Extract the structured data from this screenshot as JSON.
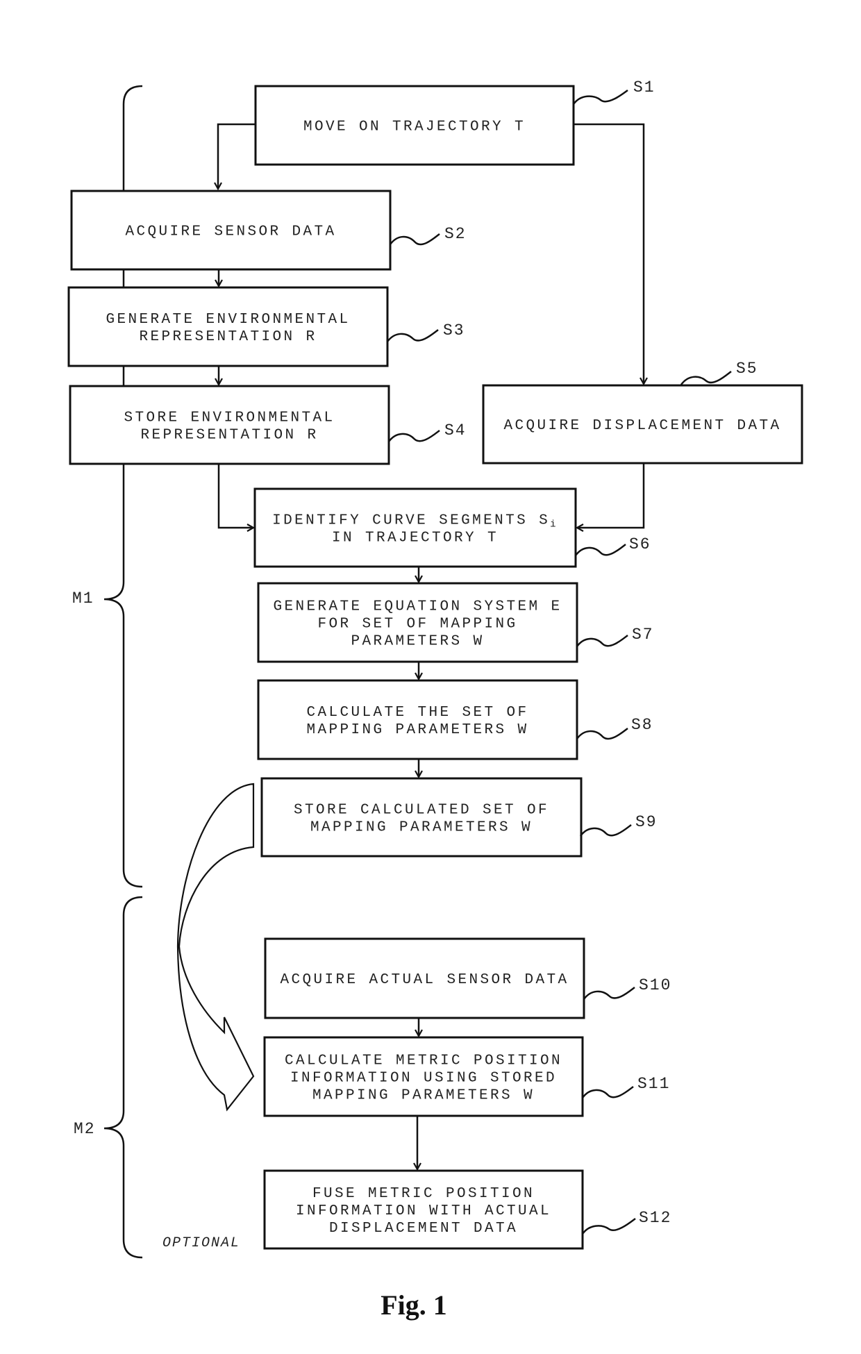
{
  "figure": {
    "caption": "Fig. 1",
    "phases": [
      {
        "id": "M1",
        "label": "M1"
      },
      {
        "id": "M2",
        "label": "M2"
      }
    ],
    "optional_note": "OPTIONAL",
    "steps": [
      {
        "id": "S1",
        "label": "S1",
        "lines": [
          "MOVE ON TRAJECTORY T"
        ]
      },
      {
        "id": "S2",
        "label": "S2",
        "lines": [
          "ACQUIRE SENSOR DATA"
        ]
      },
      {
        "id": "S3",
        "label": "S3",
        "lines": [
          "GENERATE ENVIRONMENTAL",
          "REPRESENTATION R"
        ]
      },
      {
        "id": "S4",
        "label": "S4",
        "lines": [
          "STORE ENVIRONMENTAL",
          "REPRESENTATION R"
        ]
      },
      {
        "id": "S5",
        "label": "S5",
        "lines": [
          "ACQUIRE DISPLACEMENT DATA"
        ]
      },
      {
        "id": "S6",
        "label": "S6",
        "lines": [
          "IDENTIFY CURVE SEGMENTS S",
          "IN TRAJECTORY T"
        ],
        "subscript": "i"
      },
      {
        "id": "S7",
        "label": "S7",
        "lines": [
          "GENERATE EQUATION SYSTEM E",
          "FOR SET OF MAPPING",
          "PARAMETERS W"
        ]
      },
      {
        "id": "S8",
        "label": "S8",
        "lines": [
          "CALCULATE THE SET OF",
          "MAPPING PARAMETERS W"
        ]
      },
      {
        "id": "S9",
        "label": "S9",
        "lines": [
          "STORE CALCULATED SET OF",
          "MAPPING PARAMETERS W"
        ]
      },
      {
        "id": "S10",
        "label": "S10",
        "lines": [
          "ACQUIRE ACTUAL SENSOR DATA"
        ]
      },
      {
        "id": "S11",
        "label": "S11",
        "lines": [
          "CALCULATE METRIC POSITION",
          "INFORMATION USING STORED",
          "MAPPING PARAMETERS W"
        ]
      },
      {
        "id": "S12",
        "label": "S12",
        "lines": [
          "FUSE METRIC POSITION",
          "INFORMATION WITH ACTUAL",
          "DISPLACEMENT DATA"
        ]
      }
    ]
  }
}
